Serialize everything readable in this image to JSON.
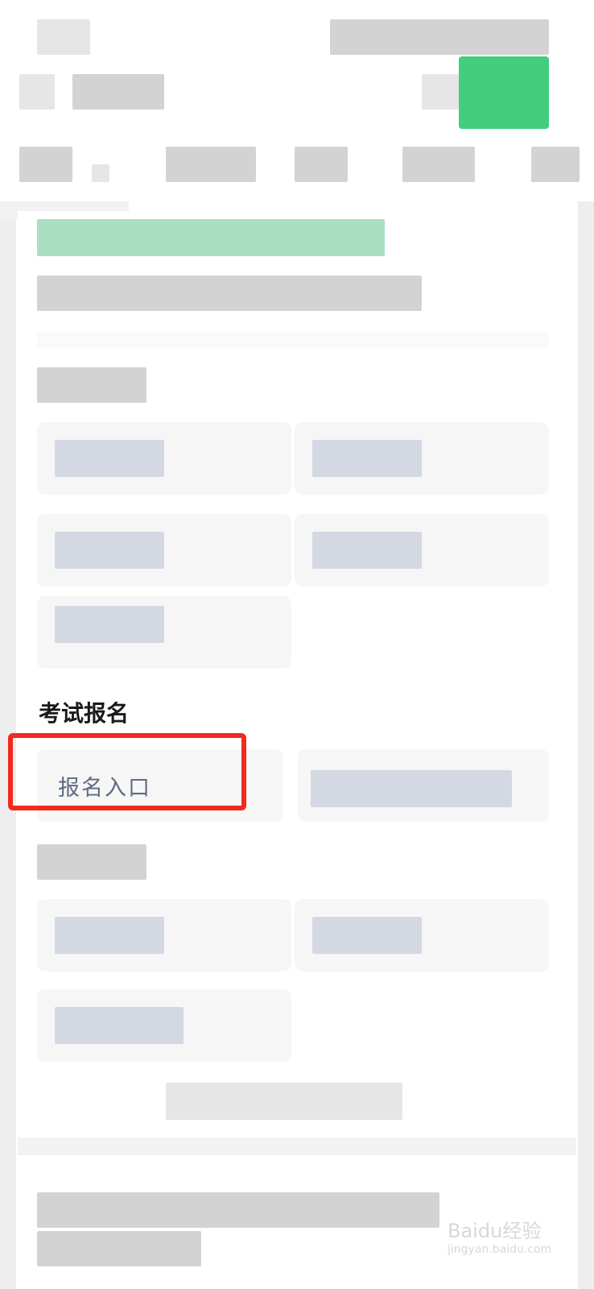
{
  "section": {
    "title": "考试报名",
    "entry_label": "报名入口"
  },
  "accent": "#23c466",
  "highlight_color": "#f02a1d",
  "watermark": {
    "brand": "Bai",
    "glyph": "du",
    "suffix": "经验",
    "url": "jingyan.baidu.com"
  }
}
